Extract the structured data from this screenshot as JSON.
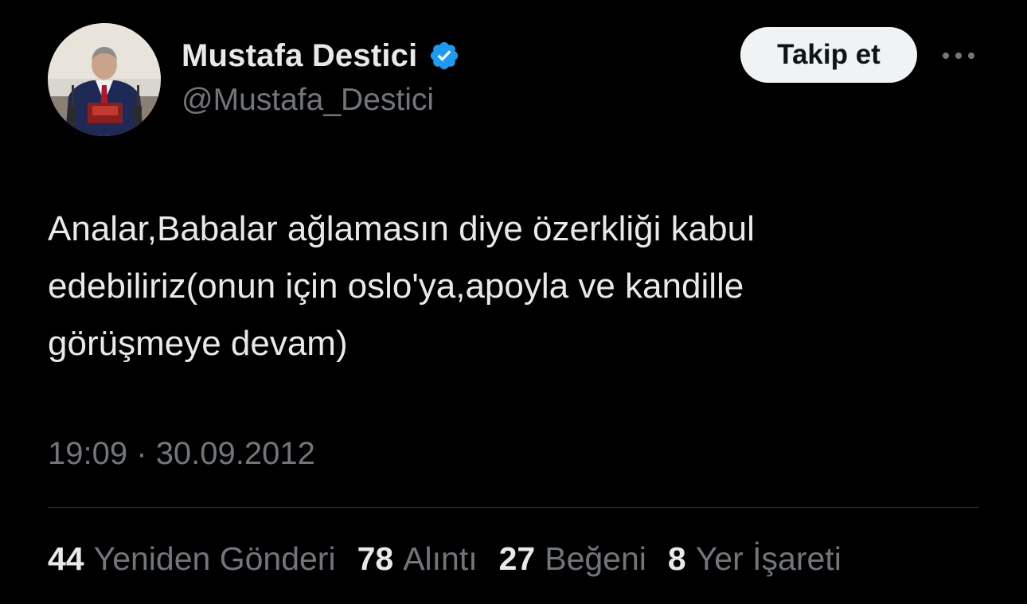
{
  "author": {
    "display_name": "Mustafa Destici",
    "handle": "@Mustafa_Destici",
    "verified": true,
    "avatar_icon": "profile-photo"
  },
  "header": {
    "follow_label": "Takip et",
    "more_icon": "ellipsis-icon"
  },
  "tweet": {
    "text": "Analar,Babalar ağlamasın diye özerkliği kabul\nedebiliriz(onun için oslo'ya,apoyla ve kandille\ngörüşmeye devam)",
    "time": "19:09",
    "separator": "·",
    "date": "30.09.2012"
  },
  "stats": [
    {
      "count": "44",
      "label": "Yeniden Gönderi"
    },
    {
      "count": "78",
      "label": "Alıntı"
    },
    {
      "count": "27",
      "label": "Beğeni"
    },
    {
      "count": "8",
      "label": "Yer İşareti"
    }
  ],
  "colors": {
    "background": "#000000",
    "primary_text": "#e7e9ea",
    "secondary_text": "#71767b",
    "verified_blue": "#1d9bf0",
    "follow_bg": "#eff3f4",
    "divider": "#2f3336"
  }
}
